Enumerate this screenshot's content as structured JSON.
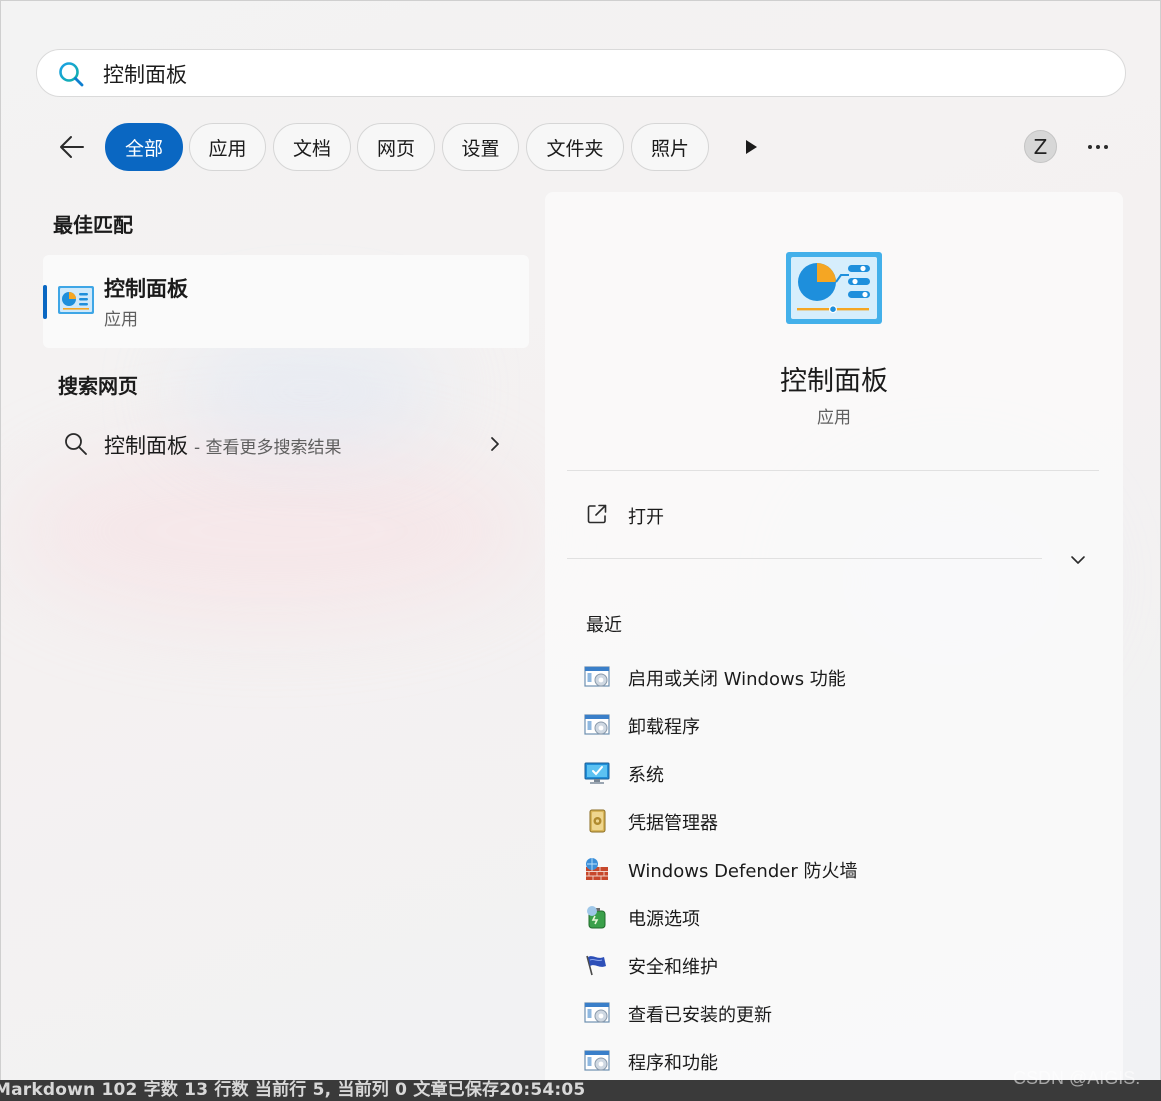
{
  "search": {
    "query": "控制面板"
  },
  "filters": {
    "tabs": [
      {
        "label": "全部",
        "active": true
      },
      {
        "label": "应用"
      },
      {
        "label": "文档"
      },
      {
        "label": "网页"
      },
      {
        "label": "设置"
      },
      {
        "label": "文件夹"
      },
      {
        "label": "照片"
      }
    ],
    "avatar_initial": "Z"
  },
  "best_match": {
    "heading": "最佳匹配",
    "name": "控制面板",
    "type": "应用"
  },
  "web_search": {
    "heading": "搜索网页",
    "query": "控制面板",
    "suffix": "- 查看更多搜索结果"
  },
  "detail": {
    "title": "控制面板",
    "subtitle": "应用",
    "open_label": "打开",
    "recent_heading": "最近",
    "recent": [
      {
        "label": "启用或关闭 Windows 功能",
        "icon": "control-panel-window-icon"
      },
      {
        "label": "卸载程序",
        "icon": "control-panel-window-icon"
      },
      {
        "label": "系统",
        "icon": "monitor-check-icon"
      },
      {
        "label": "凭据管理器",
        "icon": "credential-vault-icon"
      },
      {
        "label": "Windows Defender 防火墙",
        "icon": "firewall-globe-icon"
      },
      {
        "label": "电源选项",
        "icon": "power-battery-icon"
      },
      {
        "label": "安全和维护",
        "icon": "security-flag-icon"
      },
      {
        "label": "查看已安装的更新",
        "icon": "control-panel-window-icon"
      },
      {
        "label": "程序和功能",
        "icon": "control-panel-window-icon"
      }
    ]
  },
  "status_bar": {
    "text": "Markdown  102 字数  13 行数  当前行 5, 当前列 0  文章已保存20:54:05"
  },
  "watermark": "CSDN @AIGIS."
}
